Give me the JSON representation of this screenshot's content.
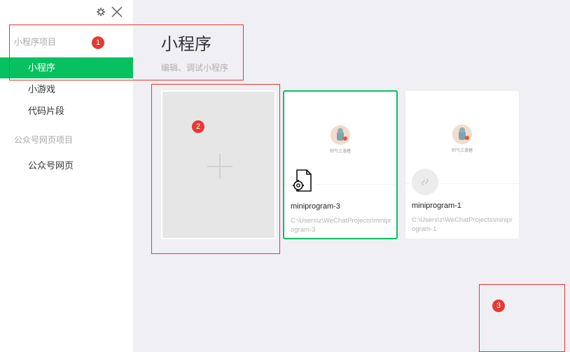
{
  "sidebar": {
    "sections": [
      {
        "title": "小程序项目",
        "items": [
          "小程序",
          "小游戏",
          "代码片段"
        ]
      },
      {
        "title": "公众号网页项目",
        "items": [
          "公众号网页"
        ]
      }
    ],
    "active_item": "小程序"
  },
  "main": {
    "title": "小程序",
    "subtitle": "编辑、调试小程序",
    "projects": [
      {
        "name": "miniprogram-3",
        "path": "C:\\Users\\z\\WeChatProjects\\miniprogram-3",
        "thumb_caption": "帅气三滑稽"
      },
      {
        "name": "miniprogram-1",
        "path": "C:\\Users\\z\\WeChatProjects\\miniprogram-1",
        "thumb_caption": "帅气三滑稽"
      }
    ]
  },
  "annotations": [
    "1",
    "2",
    "3"
  ],
  "colors": {
    "accent": "#07c160",
    "annotation": "#e53935",
    "background": "#efeff4"
  },
  "icons": [
    "settings-icon",
    "close-icon",
    "plus-icon",
    "file-gear-icon",
    "link-icon"
  ]
}
